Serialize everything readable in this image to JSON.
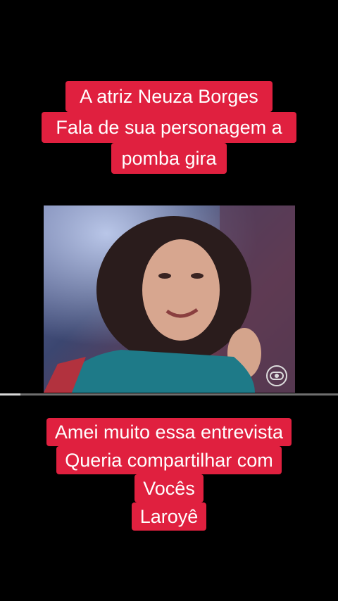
{
  "top_caption": {
    "lines": [
      "A atriz Neuza Borges",
      "Fala de sua personagem a",
      "pomba gira"
    ]
  },
  "bottom_caption": {
    "lines": [
      "Amei muito essa entrevista",
      "Queria compartilhar com",
      "Vocês",
      "Laroyê"
    ]
  },
  "video": {
    "watermark_icon": "tv-globo-logo-icon",
    "progress": 0.06
  },
  "colors": {
    "background": "#000000",
    "caption_bg": "#e0203f",
    "caption_text": "#ffffff"
  }
}
